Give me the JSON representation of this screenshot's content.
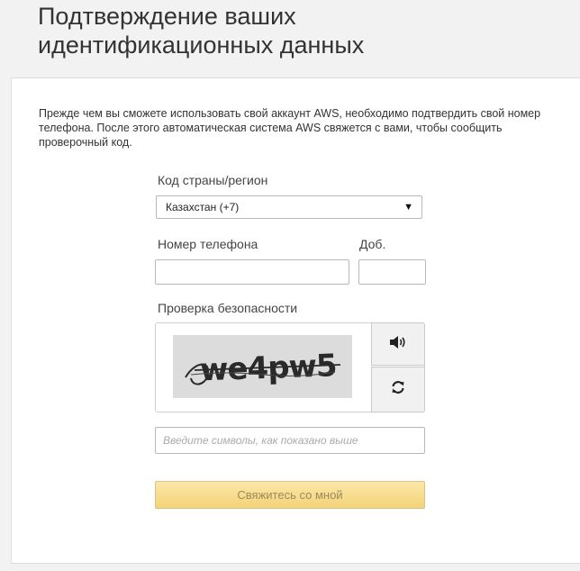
{
  "page": {
    "title_line1": "Подтверждение ваших",
    "title_line2": "идентификационных данных"
  },
  "intro": {
    "text": "Прежде чем вы сможете использовать свой аккаунт AWS, необходимо подтвердить свой номер телефона. После этого автоматическая система AWS свяжется с вами, чтобы сообщить проверочный код."
  },
  "country": {
    "label": "Код страны/регион",
    "selected": "Казахстан (+7)",
    "arrow": "▼"
  },
  "phone": {
    "label": "Номер телефона",
    "value": ""
  },
  "extension": {
    "label": "Доб.",
    "value": ""
  },
  "security": {
    "label": "Проверка безопасности"
  },
  "captcha": {
    "text": "we4pw5",
    "audio_icon": "speaker-icon",
    "refresh_icon": "refresh-icon",
    "input_placeholder": "Введите символы, как показано выше"
  },
  "submit": {
    "label": "Свяжитесь со мной"
  },
  "colors": {
    "background": "#f2f2f2",
    "button_gradient_top": "#fbe7a8",
    "button_gradient_bottom": "#f3d379",
    "button_text": "#9a8a5c"
  }
}
